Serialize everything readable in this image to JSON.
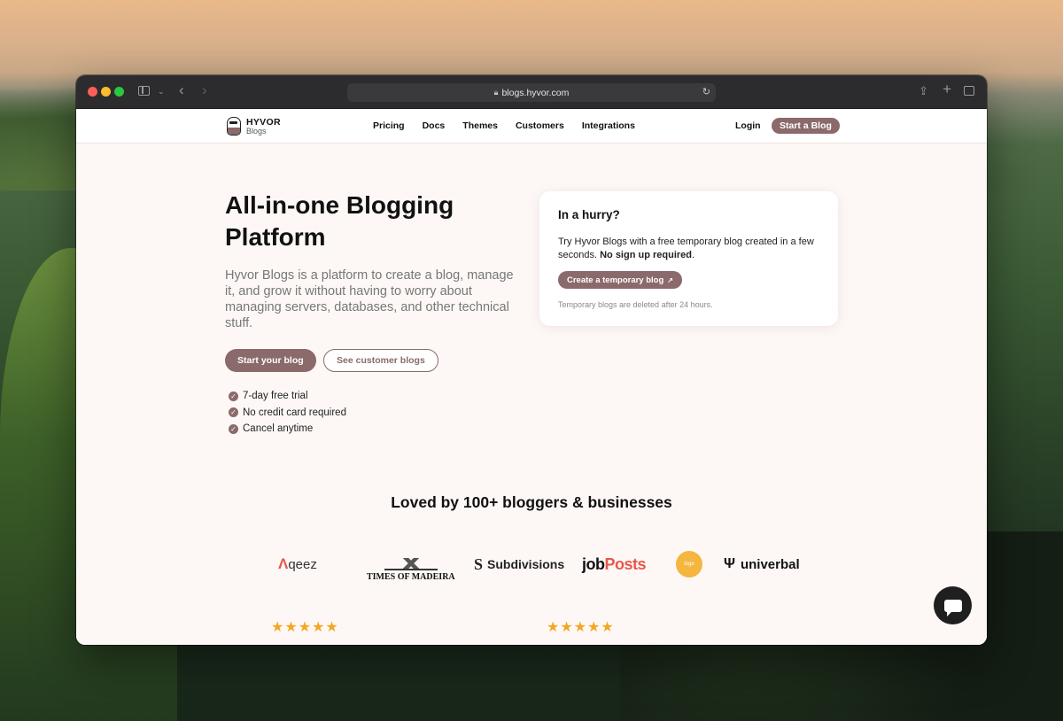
{
  "browser": {
    "url": "blogs.hyvor.com"
  },
  "navbar": {
    "logo_name": "HYVOR",
    "logo_sub": "Blogs",
    "links": [
      "Pricing",
      "Docs",
      "Themes",
      "Customers",
      "Integrations"
    ],
    "login": "Login",
    "cta": "Start a Blog"
  },
  "hero": {
    "title": "All-in-one Blogging Platform",
    "description": "Hyvor Blogs is a platform to create a blog, manage it, and grow it without having to worry about managing servers, databases, and other technical stuff.",
    "primary_button": "Start your blog",
    "secondary_button": "See customer blogs",
    "features": [
      "7-day free trial",
      "No credit card required",
      "Cancel anytime"
    ]
  },
  "hurry_card": {
    "title": "In a hurry?",
    "body_prefix": "Try Hyvor Blogs with a free temporary blog created in a few seconds.",
    "body_bold": "No sign up required",
    "body_suffix": ".",
    "button": "Create a temporary blog",
    "button_icon": "external-link-icon",
    "note": "Temporary blogs are deleted after 24 hours."
  },
  "social_proof": {
    "heading": "Loved by 100+ bloggers & businesses",
    "brands": {
      "qeez": "qeez",
      "madeira": "TIMES OF MADEIRA",
      "subdivisions": "Subdivisions",
      "job": "job",
      "posts": "Posts",
      "circle": "logo",
      "universal": "univerbal"
    },
    "ratings": [
      5,
      5
    ]
  },
  "colors": {
    "accent": "#8a6a6a",
    "star": "#f5a623",
    "background": "#fdf8f6"
  }
}
